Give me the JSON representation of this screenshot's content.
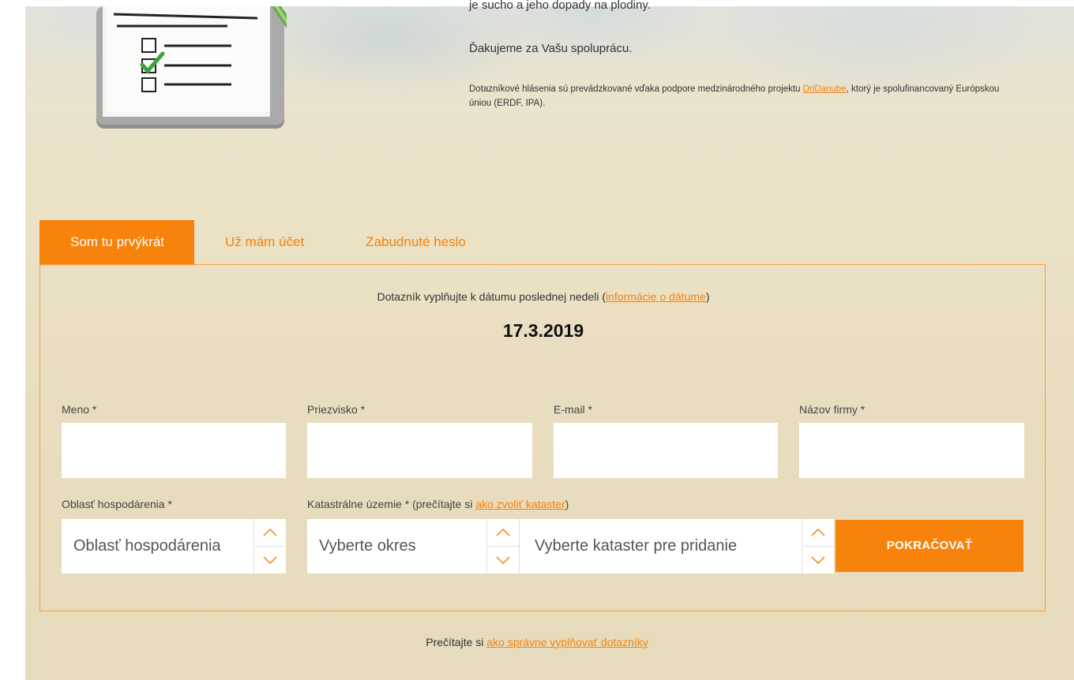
{
  "intro": {
    "partial_line": "je sucho a jeho dopady na plodiny.",
    "thanks": "Ďakujeme za Vašu spoluprácu.",
    "project_prefix": "Dotazníkové hlásenia sú prevádzkované vďaka podpore medzinárodného projektu ",
    "project_link": "DriDanube",
    "project_suffix": ", ktorý je spolufinancovaný Európskou úniou (ERDF, IPA)."
  },
  "tabs": [
    {
      "label": "Som tu prvýkrát",
      "active": true
    },
    {
      "label": "Už mám účet",
      "active": false
    },
    {
      "label": "Zabudnuté heslo",
      "active": false
    }
  ],
  "form": {
    "note_prefix": "Dotazník vyplňujte k dátumu poslednej nedeli (",
    "note_link": "informácie o dátume",
    "note_suffix": ")",
    "date": "17.3.2019",
    "fields": {
      "first_name": {
        "label": "Meno *",
        "value": ""
      },
      "last_name": {
        "label": "Priezvisko *",
        "value": ""
      },
      "email": {
        "label": "E-mail *",
        "value": ""
      },
      "company": {
        "label": "Názov firmy *",
        "value": ""
      }
    },
    "area_label": "Oblasť hospodárenia *",
    "area_value": "Oblasť hospodárenia",
    "cadastre_label_prefix": "Katastrálne územie * (prečítajte si ",
    "cadastre_label_link": "ako zvoliť kataster",
    "cadastre_label_suffix": ")",
    "district_value": "Vyberte okres",
    "cadastre_value": "Vyberte kataster pre pridanie",
    "submit": "POKRAČOVAŤ"
  },
  "footer": {
    "prefix": "Prečítajte si ",
    "link": "ako správne vyplňovať dotazníky"
  },
  "colors": {
    "accent": "#f7820c",
    "background": "#e8ddbf"
  }
}
